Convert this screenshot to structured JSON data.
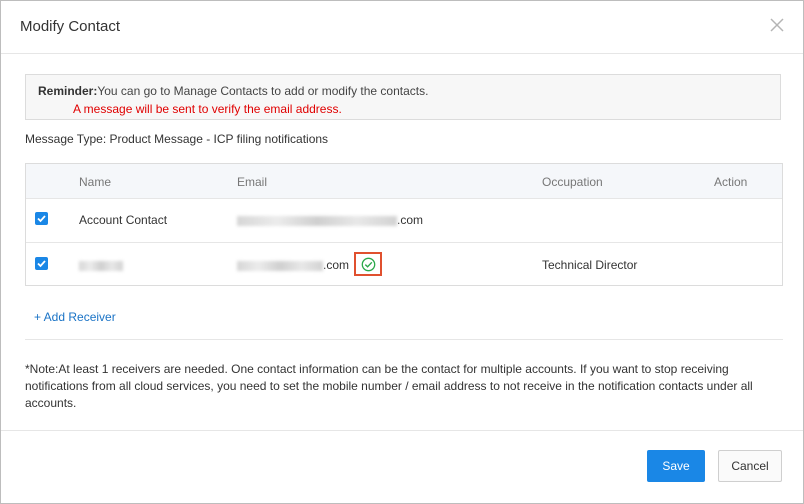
{
  "dialog": {
    "title": "Modify Contact",
    "close_icon": "close-icon"
  },
  "reminder": {
    "label": "Reminder:",
    "text": "You can go to Manage Contacts to add or modify the contacts.",
    "warning": "A message will be sent to verify the email address."
  },
  "message_type": "Message Type: Product Message - ICP filing notifications",
  "table": {
    "headers": [
      "Name",
      "Email",
      "Occupation",
      "Action"
    ],
    "rows": [
      {
        "checked": true,
        "name": "Account Contact",
        "email_suffix": ".com",
        "occupation": ""
      },
      {
        "checked": true,
        "name": "",
        "email_suffix": ".com",
        "occupation": "Technical Director",
        "verified_icon": "check-circle-icon"
      }
    ]
  },
  "add_receiver": "+ Add Receiver",
  "note": "*Note:At least 1 receivers are needed. One contact information can be the contact for multiple accounts. If you want to stop receiving notifications from all cloud services, you need to set the mobile number / email address to not receive in the notification contacts under all accounts.",
  "buttons": {
    "save": "Save",
    "cancel": "Cancel"
  },
  "colors": {
    "primary": "#1a87e6",
    "warning": "#e00000",
    "highlight": "#e0502f",
    "verified": "#2aa84a"
  }
}
